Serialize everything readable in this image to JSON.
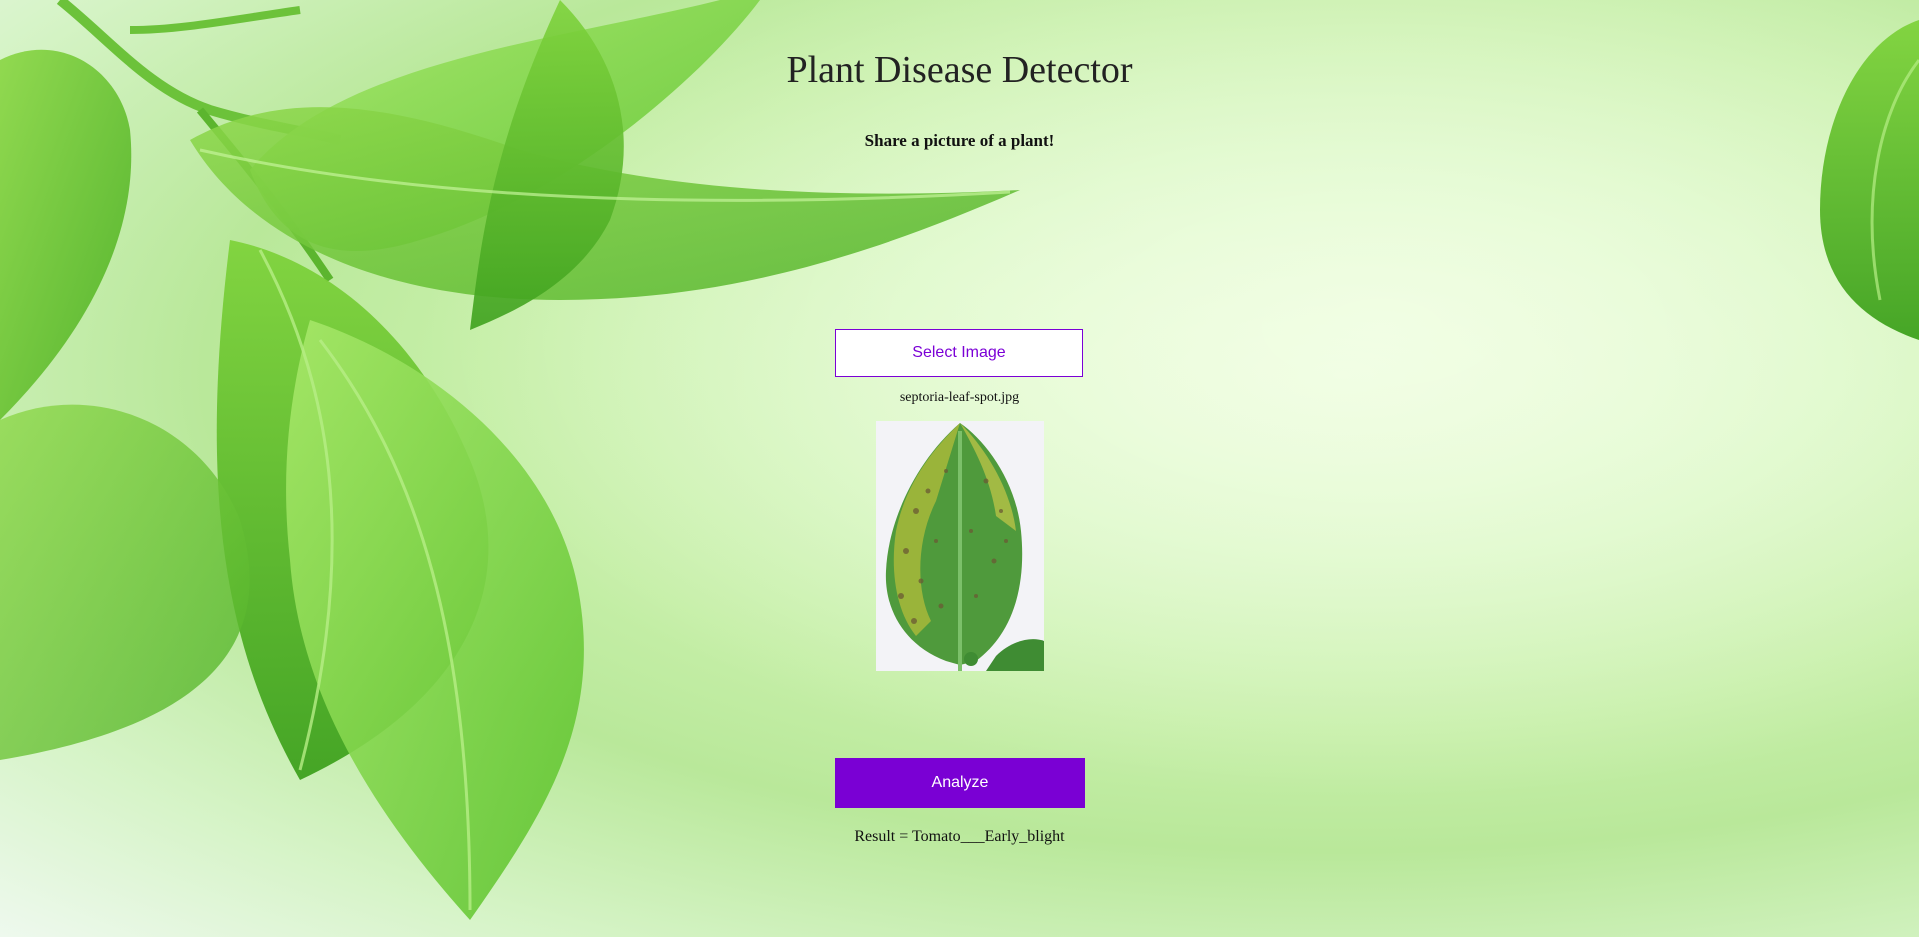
{
  "page": {
    "title": "Plant Disease Detector",
    "subtitle": "Share a picture of a plant!"
  },
  "upload": {
    "select_label": "Select Image",
    "filename": "septoria-leaf-spot.jpg",
    "preview_icon": "leaf-photo"
  },
  "analyze": {
    "label": "Analyze"
  },
  "result": {
    "text": "Result = Tomato___Early_blight"
  },
  "colors": {
    "accent": "#7a00d4",
    "background": "#c6efa8"
  }
}
